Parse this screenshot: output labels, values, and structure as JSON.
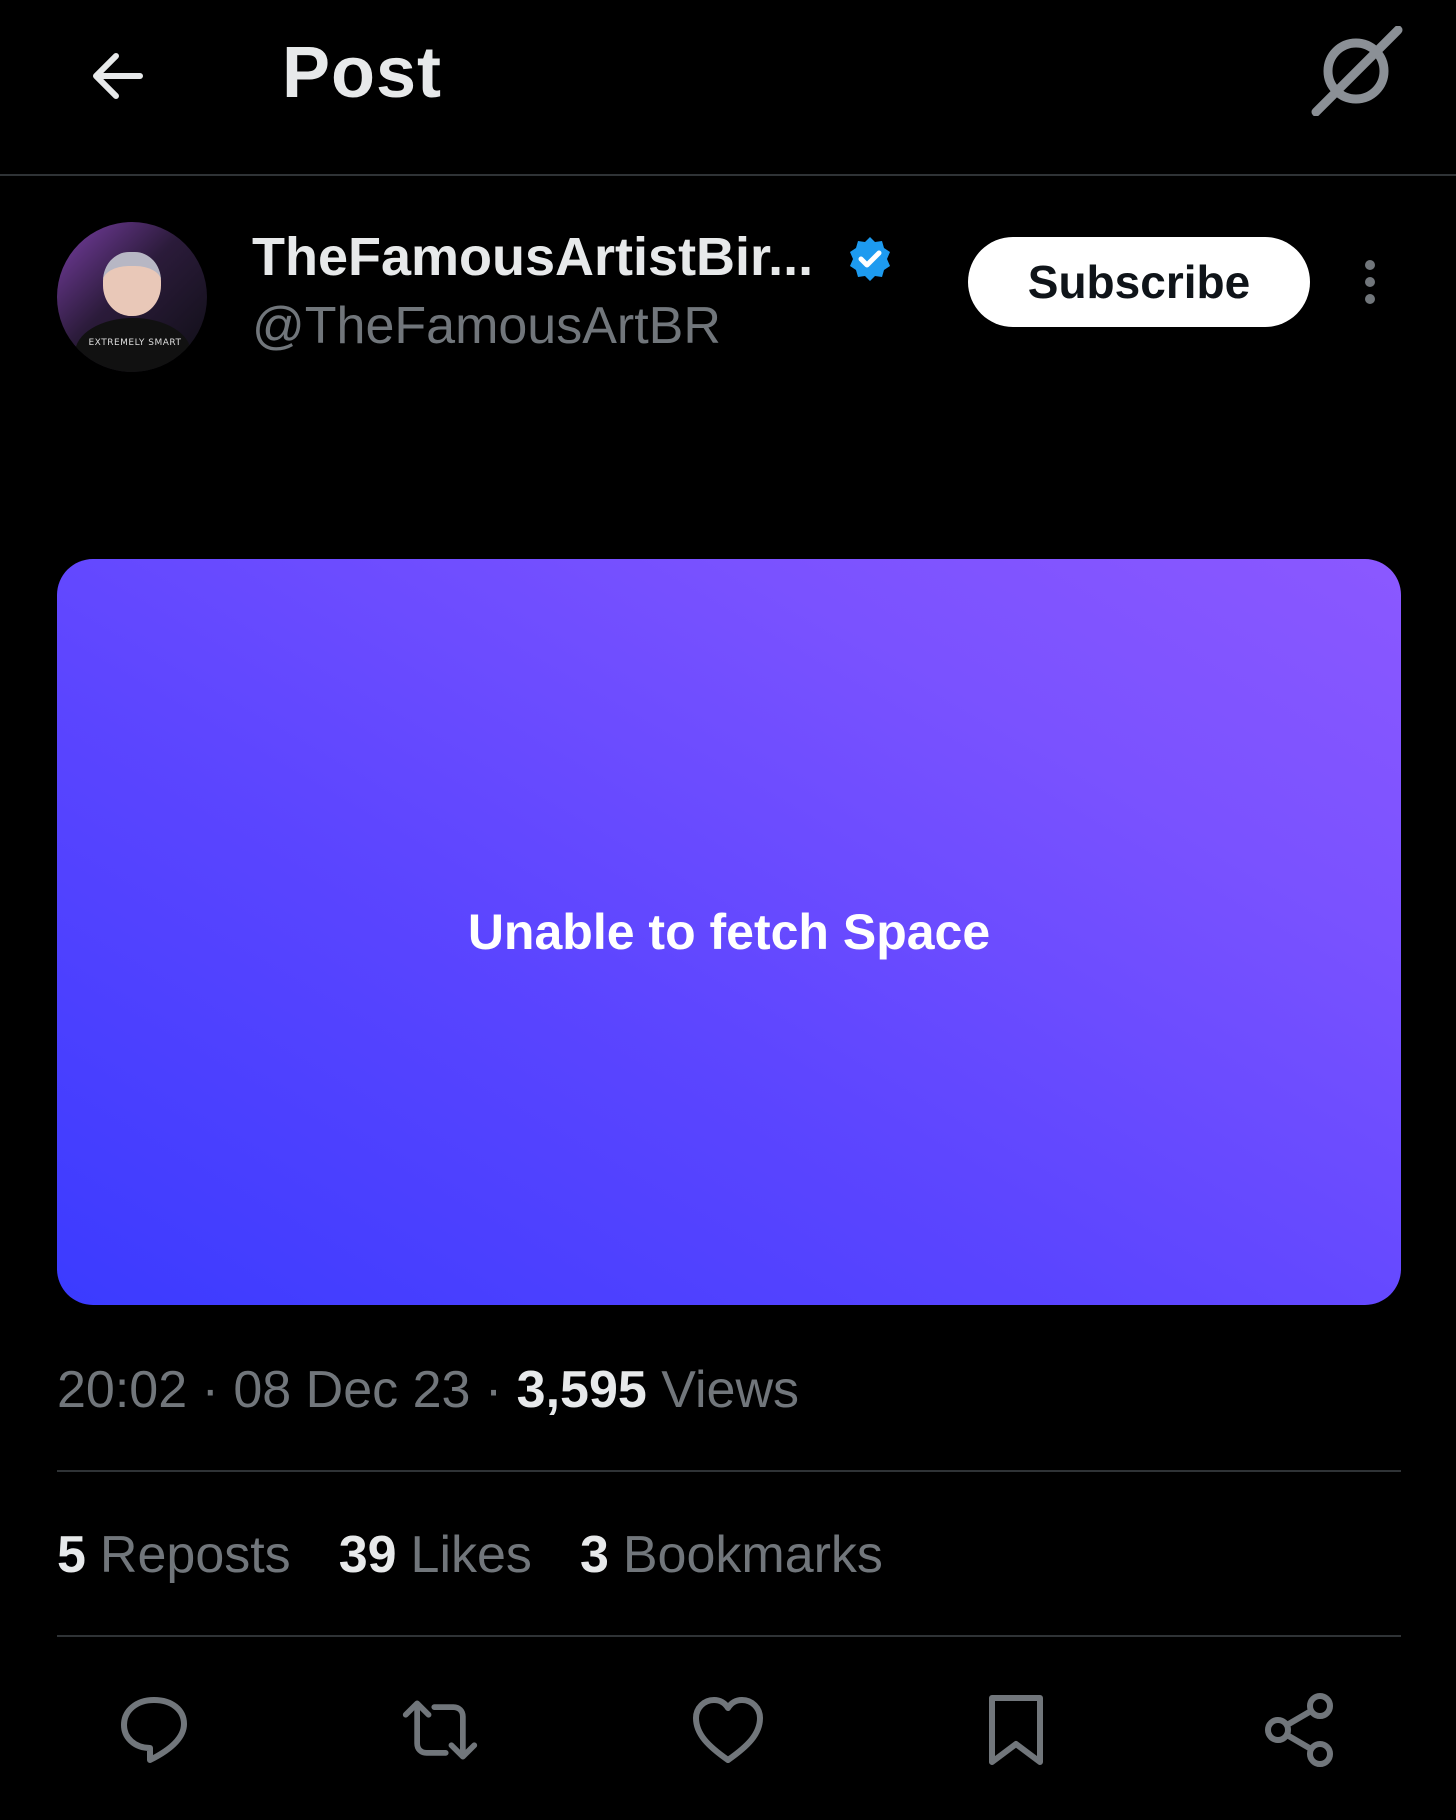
{
  "header": {
    "title": "Post",
    "back_icon": "back-arrow-icon",
    "grok_icon": "grok-icon"
  },
  "author": {
    "display_name": "TheFamousArtistBir...",
    "handle": "@TheFamousArtBR",
    "verified": true,
    "avatar_shirt_text": "EXTREMELY SMART",
    "subscribe_label": "Subscribe",
    "more_icon": "more-vertical-icon"
  },
  "space_card": {
    "message": "Unable to fetch Space",
    "gradient_colors": [
      "#3b3bff",
      "#8b58ff"
    ]
  },
  "meta": {
    "time": "20:02",
    "separator": "·",
    "date": "08 Dec 23",
    "views_count": "3,595",
    "views_label": "Views"
  },
  "stats": {
    "reposts_count": "5",
    "reposts_label": "Reposts",
    "likes_count": "39",
    "likes_label": "Likes",
    "bookmarks_count": "3",
    "bookmarks_label": "Bookmarks"
  },
  "actions": [
    "reply-icon",
    "repost-icon",
    "like-icon",
    "bookmark-icon",
    "share-icon"
  ],
  "colors": {
    "background": "#000000",
    "primary_text": "#e7e9ea",
    "secondary_text": "#71767b",
    "divider": "#2f3336",
    "verified_blue": "#1d9bf0"
  }
}
